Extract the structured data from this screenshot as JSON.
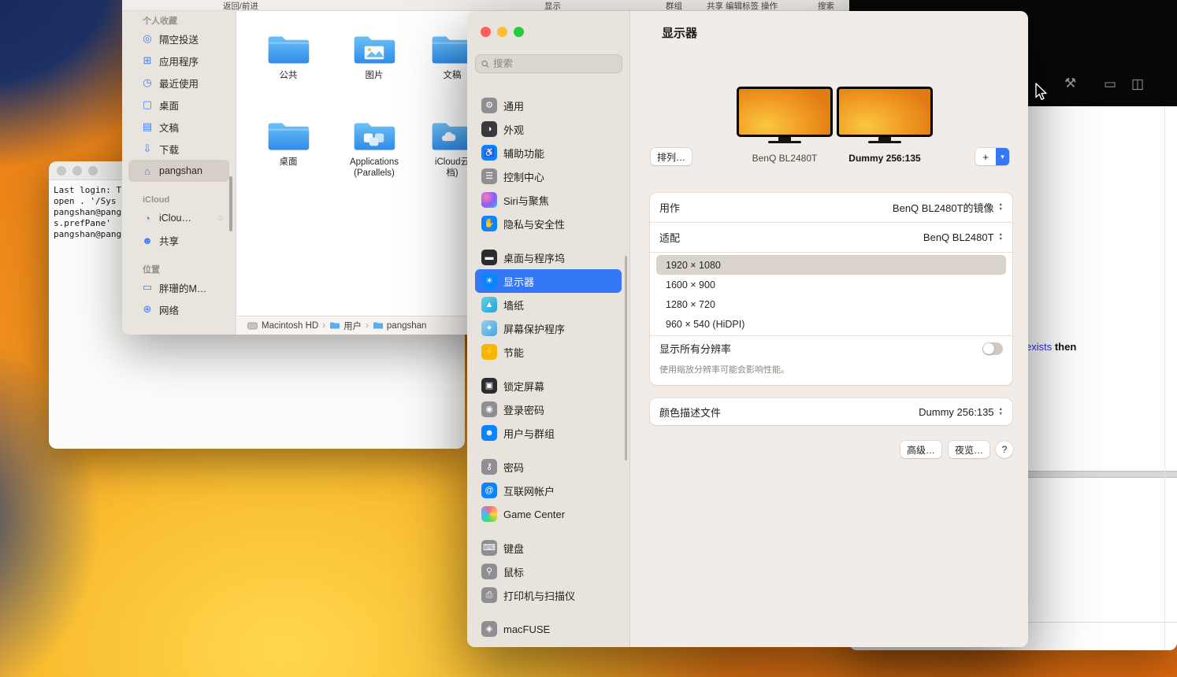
{
  "finder": {
    "toolbar": {
      "labels": [
        "返回/前进",
        "显示",
        "群组",
        "共享",
        "编辑标签",
        "操作",
        "搜索"
      ]
    },
    "sidebar": {
      "sections": [
        {
          "title": "个人收藏",
          "items": [
            {
              "id": "airdrop",
              "label": "隔空投送",
              "glyph": "◎"
            },
            {
              "id": "applications",
              "label": "应用程序",
              "glyph": "⊞"
            },
            {
              "id": "recents",
              "label": "最近使用",
              "glyph": "◷"
            },
            {
              "id": "desktop",
              "label": "桌面",
              "glyph": "▢"
            },
            {
              "id": "documents",
              "label": "文稿",
              "glyph": "▤"
            },
            {
              "id": "downloads",
              "label": "下载",
              "glyph": "⇩"
            },
            {
              "id": "home",
              "label": "pangshan",
              "glyph": "⌂",
              "selected": true
            }
          ]
        },
        {
          "title": "iCloud",
          "items": [
            {
              "id": "icloud-drive",
              "label": "iClou…",
              "glyph": "◔",
              "trailing": "◌"
            },
            {
              "id": "shared",
              "label": "共享",
              "glyph": "☻"
            }
          ]
        },
        {
          "title": "位置",
          "items": [
            {
              "id": "my-mac",
              "label": "胖珊的M…",
              "glyph": "▭"
            },
            {
              "id": "network",
              "label": "网络",
              "glyph": "⊕"
            }
          ]
        }
      ]
    },
    "folders": {
      "row1": [
        {
          "label": "公共"
        },
        {
          "label": "图片"
        },
        {
          "label": "文稿"
        }
      ],
      "row2": [
        {
          "label": "桌面"
        },
        {
          "label": "Applications\n(Parallels)"
        },
        {
          "label": "iCloud云\n档)"
        }
      ]
    },
    "path_bar": {
      "items": [
        "Macintosh HD",
        "用户",
        "pangshan"
      ],
      "separator": "›"
    }
  },
  "terminal": {
    "lines": [
      "Last login: T",
      "open . '/Sys",
      "pangshan@pang",
      "s.prefPane'",
      "pangshan@pang"
    ]
  },
  "settings": {
    "search_placeholder": "搜索",
    "sidebar_groups": [
      [
        {
          "id": "general",
          "label": "通用",
          "glyph": "⚙",
          "bg": "#8e8e93"
        },
        {
          "id": "appearance",
          "label": "外观",
          "glyph": "◑",
          "bg": "#3a3a3c"
        },
        {
          "id": "accessibility",
          "label": "辅助功能",
          "glyph": "♿",
          "bg": "#0a84ff"
        },
        {
          "id": "control-center",
          "label": "控制中心",
          "glyph": "☰",
          "bg": "#8e8e93"
        },
        {
          "id": "siri",
          "label": "Siri与聚焦",
          "glyph": "",
          "bg": "radial-gradient(circle at 30% 30%, #ff7ab8, #8a5cf6 55%, #39c2ff)"
        },
        {
          "id": "privacy",
          "label": "隐私与安全性",
          "glyph": "✋",
          "bg": "#0a84ff"
        }
      ],
      [
        {
          "id": "desktop-dock",
          "label": "桌面与程序坞",
          "glyph": "▬",
          "bg": "#2c2c2e"
        },
        {
          "id": "displays",
          "label": "显示器",
          "glyph": "☀",
          "bg": "#0a84ff",
          "selected": true
        },
        {
          "id": "wallpaper",
          "label": "墙纸",
          "glyph": "▲",
          "bg": "linear-gradient(135deg,#59d4e8,#2f9fd8)"
        },
        {
          "id": "screensaver",
          "label": "屏幕保护程序",
          "glyph": "✦",
          "bg": "linear-gradient(135deg,#8fd0f2,#4aa3e0)"
        },
        {
          "id": "energy",
          "label": "节能",
          "glyph": "⚡",
          "bg": "#f7b500"
        }
      ],
      [
        {
          "id": "lock-screen",
          "label": "锁定屏幕",
          "glyph": "▣",
          "bg": "#2c2c2e"
        },
        {
          "id": "login-password",
          "label": "登录密码",
          "glyph": "◉",
          "bg": "#8e8e93"
        },
        {
          "id": "users-groups",
          "label": "用户与群组",
          "glyph": "☻",
          "bg": "#0a84ff"
        }
      ],
      [
        {
          "id": "passwords",
          "label": "密码",
          "glyph": "⚷",
          "bg": "#8e8e93"
        },
        {
          "id": "internet-accounts",
          "label": "互联网帐户",
          "glyph": "@",
          "bg": "#0a84ff"
        },
        {
          "id": "game-center",
          "label": "Game Center",
          "glyph": "",
          "bg": "conic-gradient(#ff5f8f, #ffd23e, #4cd964, #39c2ff, #ff5f8f)"
        }
      ],
      [
        {
          "id": "keyboard",
          "label": "键盘",
          "glyph": "⌨",
          "bg": "#8e8e93"
        },
        {
          "id": "mouse",
          "label": "鼠标",
          "glyph": "⚲",
          "bg": "#8e8e93"
        },
        {
          "id": "printers",
          "label": "打印机与扫描仪",
          "glyph": "⎙",
          "bg": "#8e8e93"
        }
      ],
      [
        {
          "id": "macfuse",
          "label": "macFUSE",
          "glyph": "◈",
          "bg": "#8e8e93"
        }
      ]
    ],
    "title": "显示器",
    "displays": [
      {
        "name": "BenQ BL2480T"
      },
      {
        "name": "Dummy 256:135"
      }
    ],
    "arrange_button": "排列…",
    "add_button": "+",
    "use_as": {
      "label": "用作",
      "value": "BenQ BL2480T的镜像"
    },
    "optimize": {
      "label": "适配",
      "value": "BenQ BL2480T"
    },
    "resolutions": [
      {
        "label": "1920 × 1080",
        "selected": true
      },
      {
        "label": "1600 × 900"
      },
      {
        "label": "1280 × 720"
      },
      {
        "label": "960 × 540 (HiDPI)"
      }
    ],
    "show_all": {
      "label": "显示所有分辨率",
      "on": false
    },
    "note": "使用缩放分辨率可能会影响性能。",
    "color_profile": {
      "label": "颜色描述文件",
      "value": "Dummy 256:135"
    },
    "advanced_button": "高级…",
    "night_shift_button": "夜览…",
    "help_button": "?",
    "icons": {
      "stepper_up": "▲",
      "stepper_down": "▼",
      "add_dropdown_chevron": "▾"
    },
    "accent_color": "#3478f6"
  },
  "editor": {
    "toolbar": [
      {
        "id": "build-hammer-icon",
        "glyph": "⚒"
      },
      {
        "id": "preview-icon",
        "glyph": "▭"
      },
      {
        "id": "layout-columns-icon",
        "glyph": "◫"
      }
    ],
    "code": [
      {
        "text": "exists",
        "color": "#2a2fe0"
      },
      {
        "text": " then",
        "bold": true
      }
    ]
  }
}
